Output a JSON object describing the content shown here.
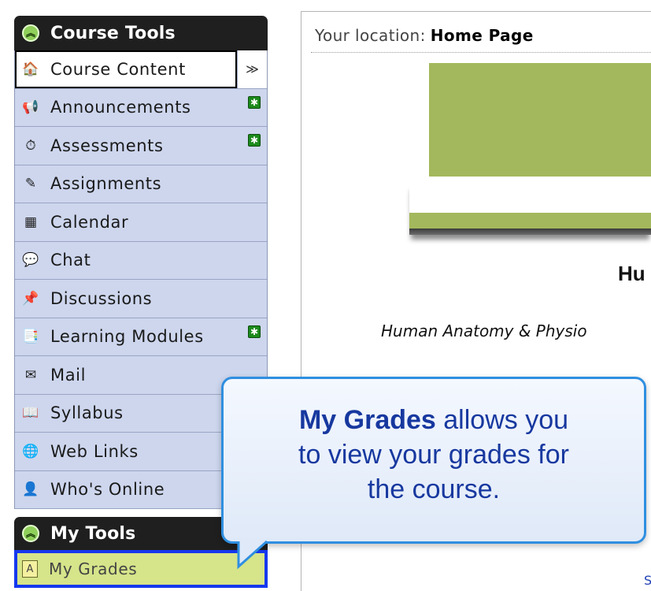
{
  "course_tools": {
    "title": "Course Tools",
    "items": [
      {
        "label": "Course Content",
        "icon": "home-icon",
        "glyph": "🏠",
        "new": false,
        "active": true
      },
      {
        "label": "Announcements",
        "icon": "megaphone-icon",
        "glyph": "📢",
        "new": true
      },
      {
        "label": "Assessments",
        "icon": "assessment-icon",
        "glyph": "⏱",
        "new": true
      },
      {
        "label": "Assignments",
        "icon": "assignment-icon",
        "glyph": "✎",
        "new": false
      },
      {
        "label": "Calendar",
        "icon": "calendar-icon",
        "glyph": "▦",
        "new": false
      },
      {
        "label": "Chat",
        "icon": "chat-icon",
        "glyph": "💬",
        "new": false
      },
      {
        "label": "Discussions",
        "icon": "discussion-pin-icon",
        "glyph": "📌",
        "new": false
      },
      {
        "label": "Learning Modules",
        "icon": "learning-modules-icon",
        "glyph": "📑",
        "new": true
      },
      {
        "label": "Mail",
        "icon": "mail-icon",
        "glyph": "✉",
        "new": false
      },
      {
        "label": "Syllabus",
        "icon": "syllabus-icon",
        "glyph": "📖",
        "new": false
      },
      {
        "label": "Web Links",
        "icon": "web-links-icon",
        "glyph": "🌐",
        "new": false
      },
      {
        "label": "Who's Online",
        "icon": "whos-online-icon",
        "glyph": "👤",
        "new": false
      }
    ],
    "collapse_glyph": "≫"
  },
  "my_tools": {
    "title": "My Tools",
    "items": [
      {
        "label": "My Grades",
        "icon": "grades-icon",
        "glyph": "A"
      }
    ]
  },
  "breadcrumb": {
    "prefix": "Your location:",
    "page": "Home Page"
  },
  "course": {
    "title": "Hu",
    "subtitle": "Human Anatomy & Physio",
    "stray_link": "S"
  },
  "callout": {
    "highlight": "My Grades",
    "line1_rest": " allows you",
    "line2": "to view your grades for",
    "line3": "the course."
  },
  "colors": {
    "header_bg": "#1f1f1f",
    "list_bg": "#cdd6ed",
    "banner": "#a3b85c",
    "highlight_border": "#1538ef",
    "mygrades_bg": "#d6e48a",
    "callout_border": "#2f8fe0",
    "callout_text": "#17389f",
    "new_badge": "#1c8a1c"
  }
}
